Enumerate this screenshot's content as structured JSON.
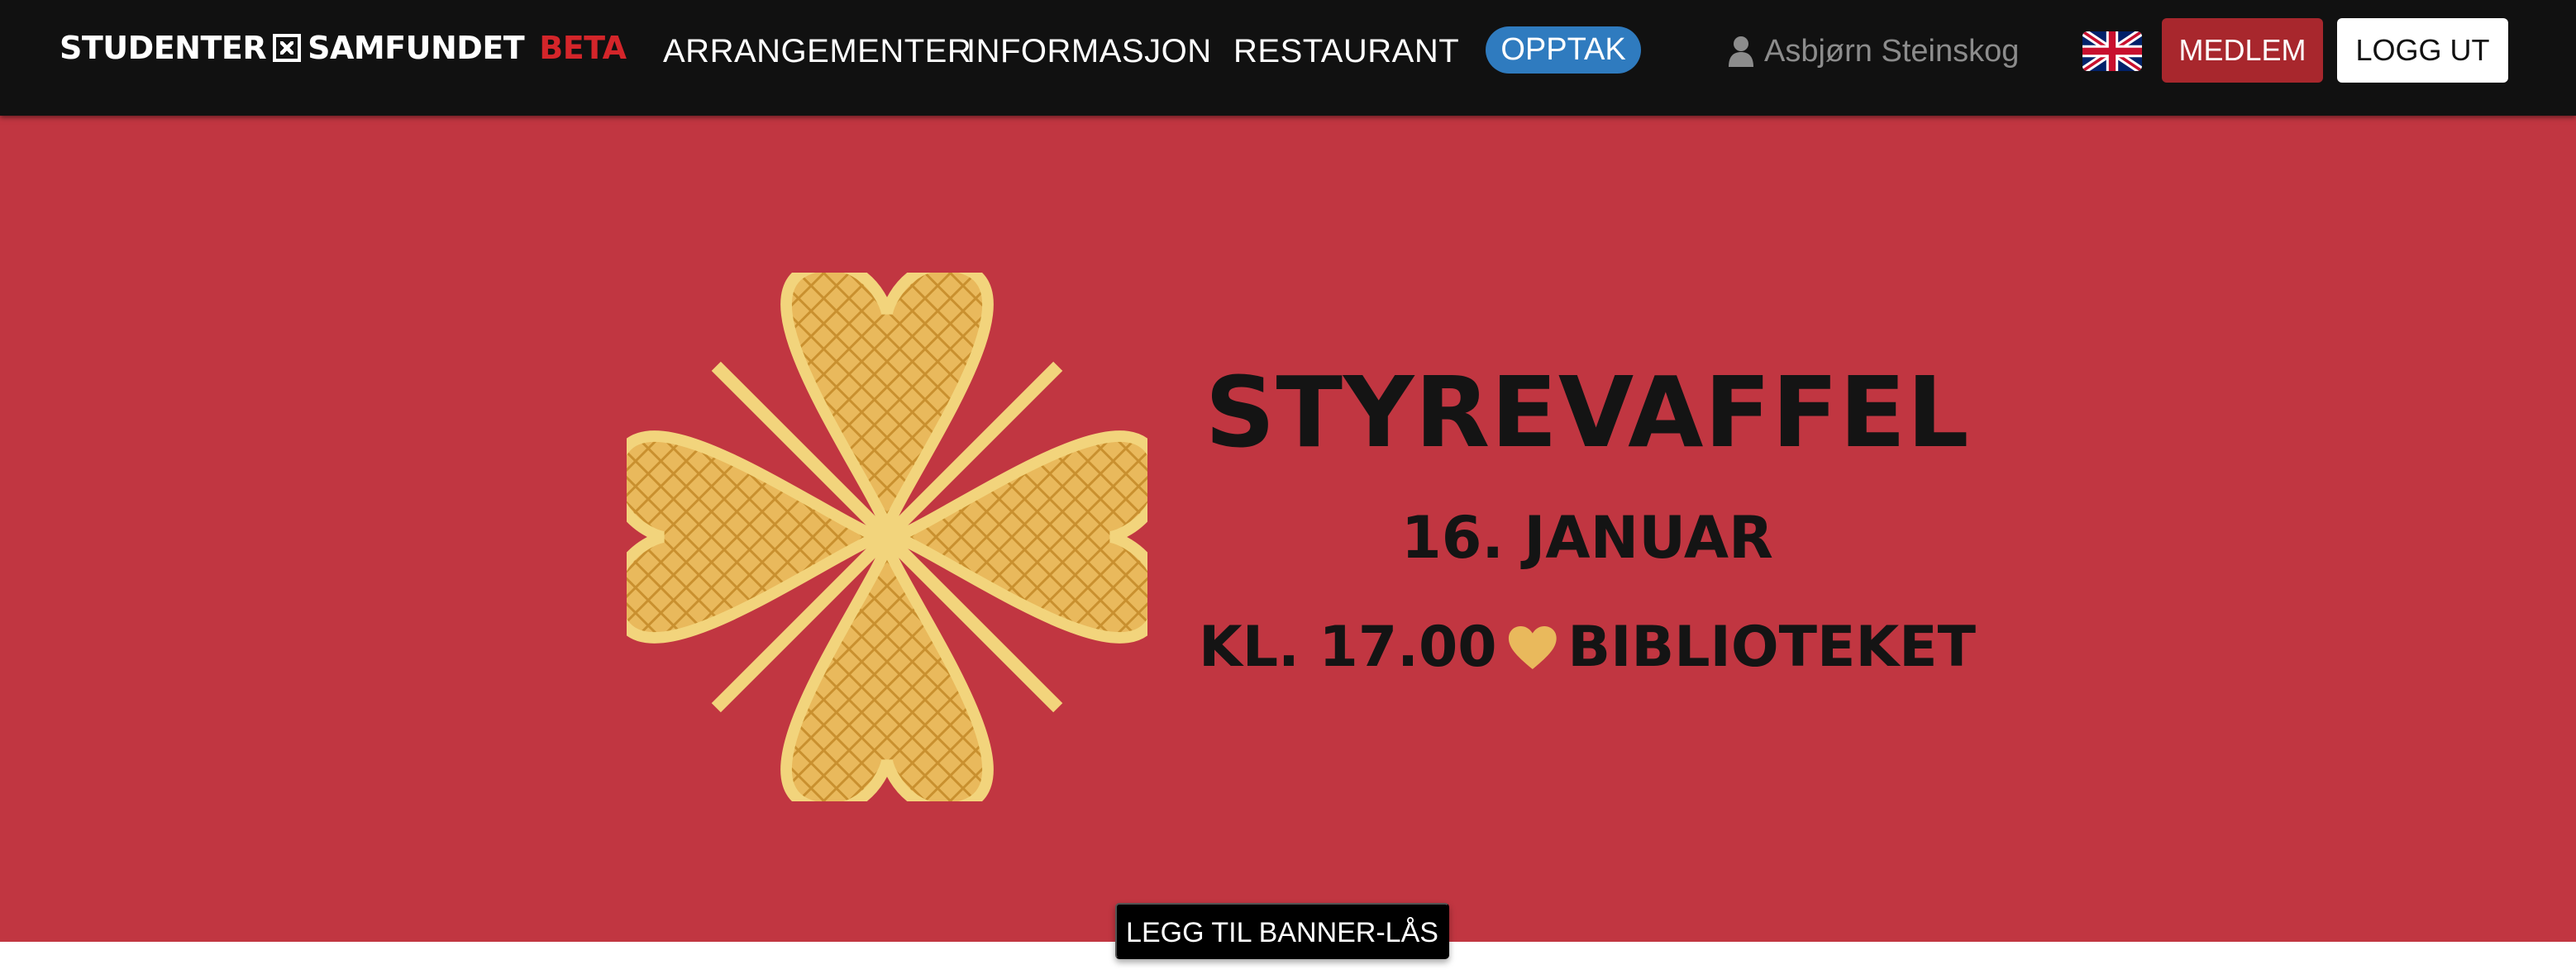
{
  "header": {
    "logo_text_1": "STUDENTER",
    "logo_text_2": "SAMFUNDET",
    "logo_beta": "BETA",
    "nav": {
      "arrangementer": "ARRANGEMENTER",
      "informasjon": "INFORMASJON",
      "restaurant": "RESTAURANT",
      "opptak": "OPPTAK"
    },
    "user_name": "Asbjørn Steinskog",
    "language_icon": "uk-flag-icon",
    "member_button": "MEDLEM",
    "logout_button": "LOGG UT"
  },
  "banner": {
    "title": "STYREVAFFEL",
    "date": "16. JANUAR",
    "time": "KL. 17.00",
    "location": "BIBLIOTEKET",
    "lock_button": "LEGG TIL BANNER-LÅS"
  },
  "colors": {
    "navbar_bg": "#111111",
    "banner_bg": "#c13641",
    "opptak_bg": "#2f7bbf",
    "medlem_bg": "#a8272d",
    "beta_red": "#d4252a",
    "waffle_gold": "#e9b95c"
  }
}
